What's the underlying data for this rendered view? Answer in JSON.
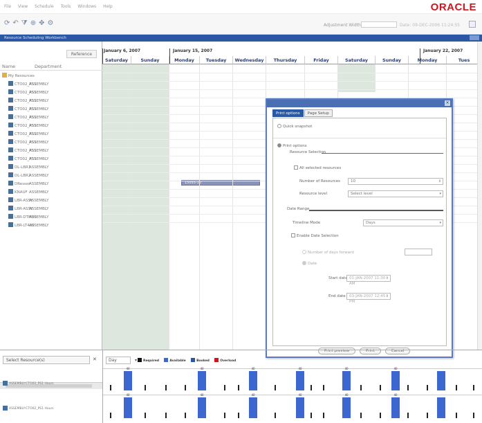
{
  "menubar": {
    "items": [
      "File",
      "View",
      "Schedule",
      "Tools",
      "Windows",
      "Help"
    ],
    "brand": "ORACLE"
  },
  "toolbar": {
    "utilities_label": "Adjustment Width",
    "date_label": "Date: 09-DEC-2006 11:24:55"
  },
  "window_title": "Resource Scheduling Workbench",
  "left": {
    "reference_button": "Reference",
    "col_name": "Name",
    "col_department": "Department",
    "tree": [
      {
        "name": "My Resources",
        "dept": "",
        "root": true
      },
      {
        "name": "CTO02_PS1",
        "dept": "ASSEMBLY"
      },
      {
        "name": "CTO02_PS1",
        "dept": "ASSEMBLY"
      },
      {
        "name": "CTO02_PS1",
        "dept": "ASSEMBLY"
      },
      {
        "name": "CTO02_PS1",
        "dept": "ASSEMBLY"
      },
      {
        "name": "CTO02_PS1",
        "dept": "ASSEMBLY"
      },
      {
        "name": "CTO02_PS1",
        "dept": "ASSEMBLY"
      },
      {
        "name": "CTO02_PS1",
        "dept": "ASSEMBLY"
      },
      {
        "name": "CTO02_PS1",
        "dept": "ASSEMBLY"
      },
      {
        "name": "CTO02_PS1",
        "dept": "ASSEMBLY"
      },
      {
        "name": "CTO02_PS1",
        "dept": "ASSEMBLY"
      },
      {
        "name": "DL-LBR1",
        "dept": "ASSEMBLY"
      },
      {
        "name": "DL-LBR2",
        "dept": "ASSEMBLY"
      },
      {
        "name": "DRessor",
        "dept": "ASSEMBLY"
      },
      {
        "name": "KNAUF",
        "dept": "ASSEMBLY"
      },
      {
        "name": "LBR-ASSY",
        "dept": "ASSEMBLY"
      },
      {
        "name": "LBR-ASSY",
        "dept": "ASSEMBLY"
      },
      {
        "name": "LBR-DTM00",
        "dept": "ASSEMBLY"
      },
      {
        "name": "LBR-LT400",
        "dept": "ASSEMBLY"
      }
    ]
  },
  "grid": {
    "weeks": [
      "January 6, 2007",
      "January 15, 2007",
      "January 22, 2007"
    ],
    "days": [
      "Saturday",
      "Sunday",
      "Monday",
      "Tuesday",
      "Wednesday",
      "Thursday",
      "Friday",
      "Saturday",
      "Sunday",
      "Monday",
      "Tues"
    ],
    "task_label": "15055-10"
  },
  "dialog": {
    "tabs": [
      "Print options",
      "Page Setup"
    ],
    "quick_snapshot": "Quick snapshot",
    "print_options": "Print options",
    "resource_selection": "Resource Selection",
    "all_selected": "All selected resources",
    "num_resources_label": "Number of Resources",
    "num_resources_value": "10",
    "resource_level_label": "Resource level",
    "resource_level_value": "Select level",
    "date_range": "Date Range",
    "timeline_mode_label": "Timeline Mode",
    "timeline_mode_value": "Days",
    "enable_date_selection": "Enable Date Selection",
    "number_days_forward": "Number of days forward",
    "date_option": "Date",
    "start_date_label": "Start date",
    "start_date_value": "01-JAN-2007 11:30 AM",
    "end_date_label": "End date",
    "end_date_value": "03-JAN-2007 12:45 PM",
    "buttons": [
      "Print preview",
      "Print",
      "Cancel"
    ]
  },
  "bottom": {
    "select_resource": "Select Resource(s)",
    "histogram_unit": "Day",
    "legend": [
      {
        "label": "Required",
        "color": "#111111"
      },
      {
        "label": "Available",
        "color": "#3c67d0"
      },
      {
        "label": "Booked",
        "color": "#2b58a4"
      },
      {
        "label": "Overload",
        "color": "#d4141b"
      }
    ],
    "resource_rows": [
      "ASSEMBLY:CTO02_PS1 Hours",
      "ASSEMBLY:CTO02_PS1 Hours"
    ],
    "hist_values": [
      "40",
      "40",
      "40",
      "40",
      "40",
      "40"
    ]
  }
}
